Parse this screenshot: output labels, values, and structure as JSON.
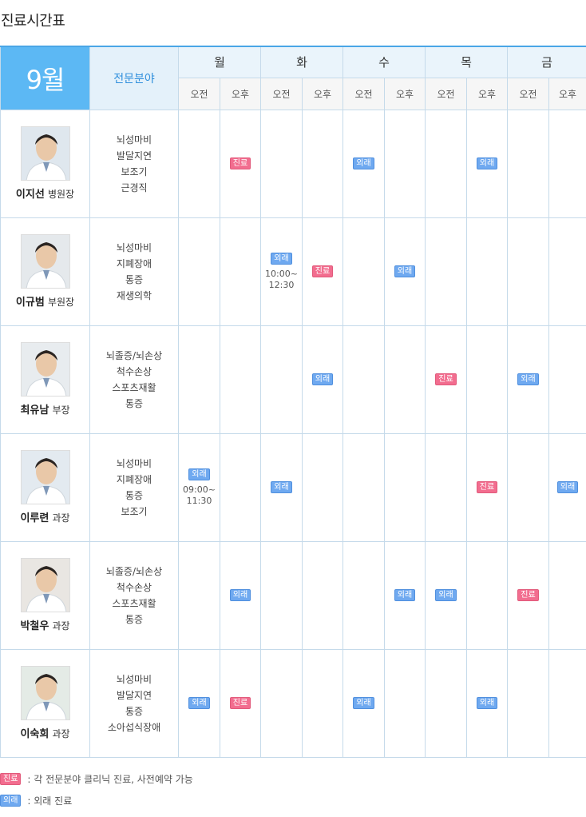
{
  "page": {
    "title": "진료시간표"
  },
  "table": {
    "month": "9월",
    "specialty_header": "전문분야",
    "days": [
      "월",
      "화",
      "수",
      "목",
      "금"
    ],
    "halves": [
      "오전",
      "오후"
    ],
    "badge_labels": {
      "clinic": "진료",
      "out": "외래"
    },
    "doctors": [
      {
        "name": "이지선",
        "role": "병원장",
        "specialties": [
          "뇌성마비",
          "발달지연",
          "보조기",
          "근경직"
        ],
        "slots": [
          null,
          "clinic",
          null,
          null,
          "out",
          null,
          null,
          "out",
          null,
          null
        ],
        "times": {}
      },
      {
        "name": "이규범",
        "role": "부원장",
        "specialties": [
          "뇌성마비",
          "지폐장애",
          "통증",
          "재생의학"
        ],
        "slots": [
          null,
          null,
          "out",
          "clinic",
          null,
          "out",
          null,
          null,
          null,
          null
        ],
        "times": {
          "2": [
            "10:00~",
            "12:30"
          ]
        }
      },
      {
        "name": "최유남",
        "role": "부장",
        "specialties": [
          "뇌졸증/뇌손상",
          "척수손상",
          "스포츠재활",
          "통증"
        ],
        "slots": [
          null,
          null,
          null,
          "out",
          null,
          null,
          "clinic",
          null,
          "out",
          null
        ],
        "times": {}
      },
      {
        "name": "이루련",
        "role": "과장",
        "specialties": [
          "뇌성마비",
          "지폐장애",
          "통증",
          "보조기"
        ],
        "slots": [
          "out",
          null,
          "out",
          null,
          null,
          null,
          null,
          "clinic",
          null,
          "out"
        ],
        "times": {
          "0": [
            "09:00~",
            "11:30"
          ]
        }
      },
      {
        "name": "박철우",
        "role": "과장",
        "specialties": [
          "뇌졸증/뇌손상",
          "척수손상",
          "스포츠재활",
          "통증"
        ],
        "slots": [
          null,
          "out",
          null,
          null,
          null,
          "out",
          "out",
          null,
          "clinic",
          null
        ],
        "times": {}
      },
      {
        "name": "이숙희",
        "role": "과장",
        "specialties": [
          "뇌성마비",
          "발달지연",
          "통증",
          "소아섭식장애"
        ],
        "slots": [
          "out",
          "clinic",
          null,
          null,
          "out",
          null,
          null,
          "out",
          null,
          null
        ],
        "times": {}
      }
    ]
  },
  "legend": [
    {
      "badge": "진료",
      "type": "clinic",
      "text": ": 각 전문분야 클리닉 진료, 사전예약 가능"
    },
    {
      "badge": "외래",
      "type": "out",
      "text": ": 외래 진료"
    }
  ],
  "colors": {
    "accent": "#5cb8f4",
    "clinic_badge": "#f26d8f",
    "out_badge": "#6fa9f0",
    "border": "#c5daea"
  }
}
